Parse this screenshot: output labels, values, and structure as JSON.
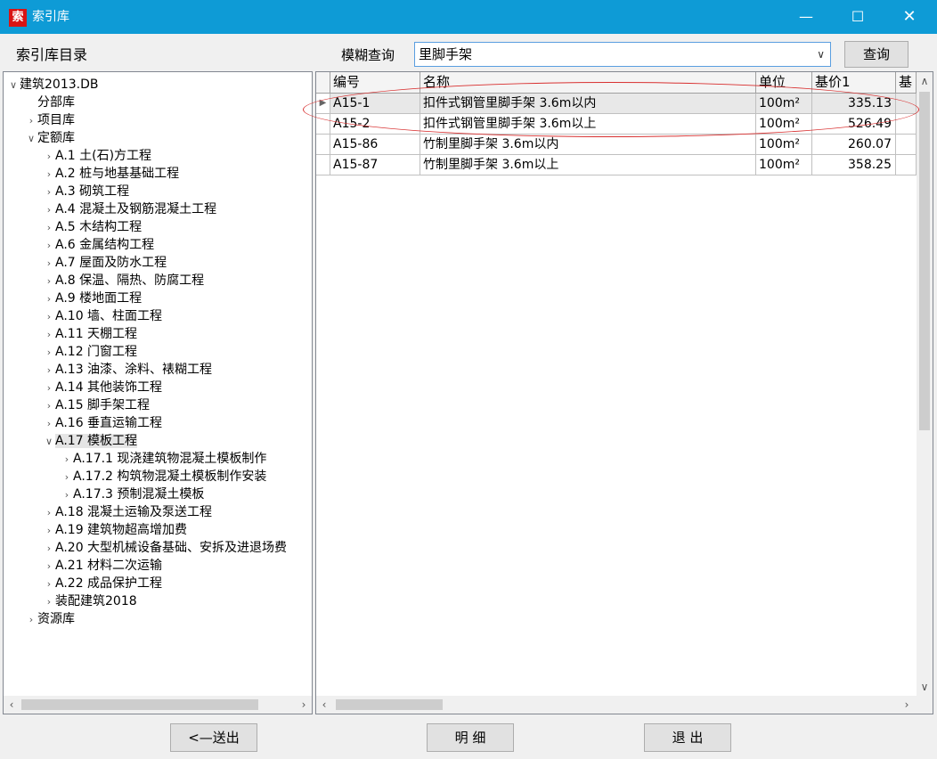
{
  "window": {
    "app_icon_glyph": "索",
    "title": "索引库",
    "min_glyph": "—",
    "max_glyph": "☐",
    "close_glyph": "✕"
  },
  "header": {
    "catalog_label": "索引库目录",
    "search_label": "模糊查询",
    "search_value": "里脚手架",
    "dropdown_glyph": "∨",
    "query_button": "查询"
  },
  "tree": {
    "items": [
      {
        "label": "建筑2013.DB",
        "toggle": "∨",
        "level": 0
      },
      {
        "label": "分部库",
        "toggle": "",
        "level": 1
      },
      {
        "label": "项目库",
        "toggle": "›",
        "level": 1
      },
      {
        "label": "定额库",
        "toggle": "∨",
        "level": 1
      },
      {
        "label": "A.1 土(石)方工程",
        "toggle": "›",
        "level": 2
      },
      {
        "label": "A.2 桩与地基基础工程",
        "toggle": "›",
        "level": 2
      },
      {
        "label": "A.3 砌筑工程",
        "toggle": "›",
        "level": 2
      },
      {
        "label": "A.4 混凝土及钢筋混凝土工程",
        "toggle": "›",
        "level": 2
      },
      {
        "label": "A.5 木结构工程",
        "toggle": "›",
        "level": 2
      },
      {
        "label": "A.6 金属结构工程",
        "toggle": "›",
        "level": 2
      },
      {
        "label": "A.7 屋面及防水工程",
        "toggle": "›",
        "level": 2
      },
      {
        "label": "A.8 保温、隔热、防腐工程",
        "toggle": "›",
        "level": 2
      },
      {
        "label": "A.9 楼地面工程",
        "toggle": "›",
        "level": 2
      },
      {
        "label": "A.10 墙、柱面工程",
        "toggle": "›",
        "level": 2
      },
      {
        "label": "A.11 天棚工程",
        "toggle": "›",
        "level": 2
      },
      {
        "label": "A.12 门窗工程",
        "toggle": "›",
        "level": 2
      },
      {
        "label": "A.13 油漆、涂料、裱糊工程",
        "toggle": "›",
        "level": 2
      },
      {
        "label": "A.14 其他装饰工程",
        "toggle": "›",
        "level": 2
      },
      {
        "label": "A.15 脚手架工程",
        "toggle": "›",
        "level": 2
      },
      {
        "label": "A.16 垂直运输工程",
        "toggle": "›",
        "level": 2
      },
      {
        "label": "A.17 模板工程",
        "toggle": "∨",
        "level": 2,
        "selected": true
      },
      {
        "label": "A.17.1 现浇建筑物混凝土模板制作",
        "toggle": "›",
        "level": 3
      },
      {
        "label": "A.17.2 构筑物混凝土模板制作安装",
        "toggle": "›",
        "level": 3
      },
      {
        "label": "A.17.3 预制混凝土模板",
        "toggle": "›",
        "level": 3
      },
      {
        "label": "A.18 混凝土运输及泵送工程",
        "toggle": "›",
        "level": 2
      },
      {
        "label": "A.19 建筑物超高增加费",
        "toggle": "›",
        "level": 2
      },
      {
        "label": "A.20 大型机械设备基础、安拆及进退场费",
        "toggle": "›",
        "level": 2
      },
      {
        "label": "A.21 材料二次运输",
        "toggle": "›",
        "level": 2
      },
      {
        "label": "A.22 成品保护工程",
        "toggle": "›",
        "level": 2
      },
      {
        "label": "装配建筑2018",
        "toggle": "›",
        "level": 2
      },
      {
        "label": "资源库",
        "toggle": "›",
        "level": 1
      }
    ],
    "scroll_left": "‹",
    "scroll_right": "›"
  },
  "grid": {
    "columns": [
      "编号",
      "名称",
      "单位",
      "基价1",
      "基"
    ],
    "rows": [
      {
        "code": "A15-1",
        "name": "扣件式钢管里脚手架 3.6m以内",
        "unit": "100m²",
        "price": "335.13",
        "marker": "▶"
      },
      {
        "code": "A15-2",
        "name": "扣件式钢管里脚手架 3.6m以上",
        "unit": "100m²",
        "price": "526.49",
        "marker": ""
      },
      {
        "code": "A15-86",
        "name": "竹制里脚手架 3.6m以内",
        "unit": "100m²",
        "price": "260.07",
        "marker": ""
      },
      {
        "code": "A15-87",
        "name": "竹制里脚手架 3.6m以上",
        "unit": "100m²",
        "price": "358.25",
        "marker": ""
      }
    ],
    "scroll_up": "∧",
    "scroll_down": "∨",
    "scroll_left": "‹",
    "scroll_right": "›"
  },
  "footer": {
    "send_button": "<—送出",
    "detail_button": "明 细",
    "exit_button": "退 出"
  }
}
